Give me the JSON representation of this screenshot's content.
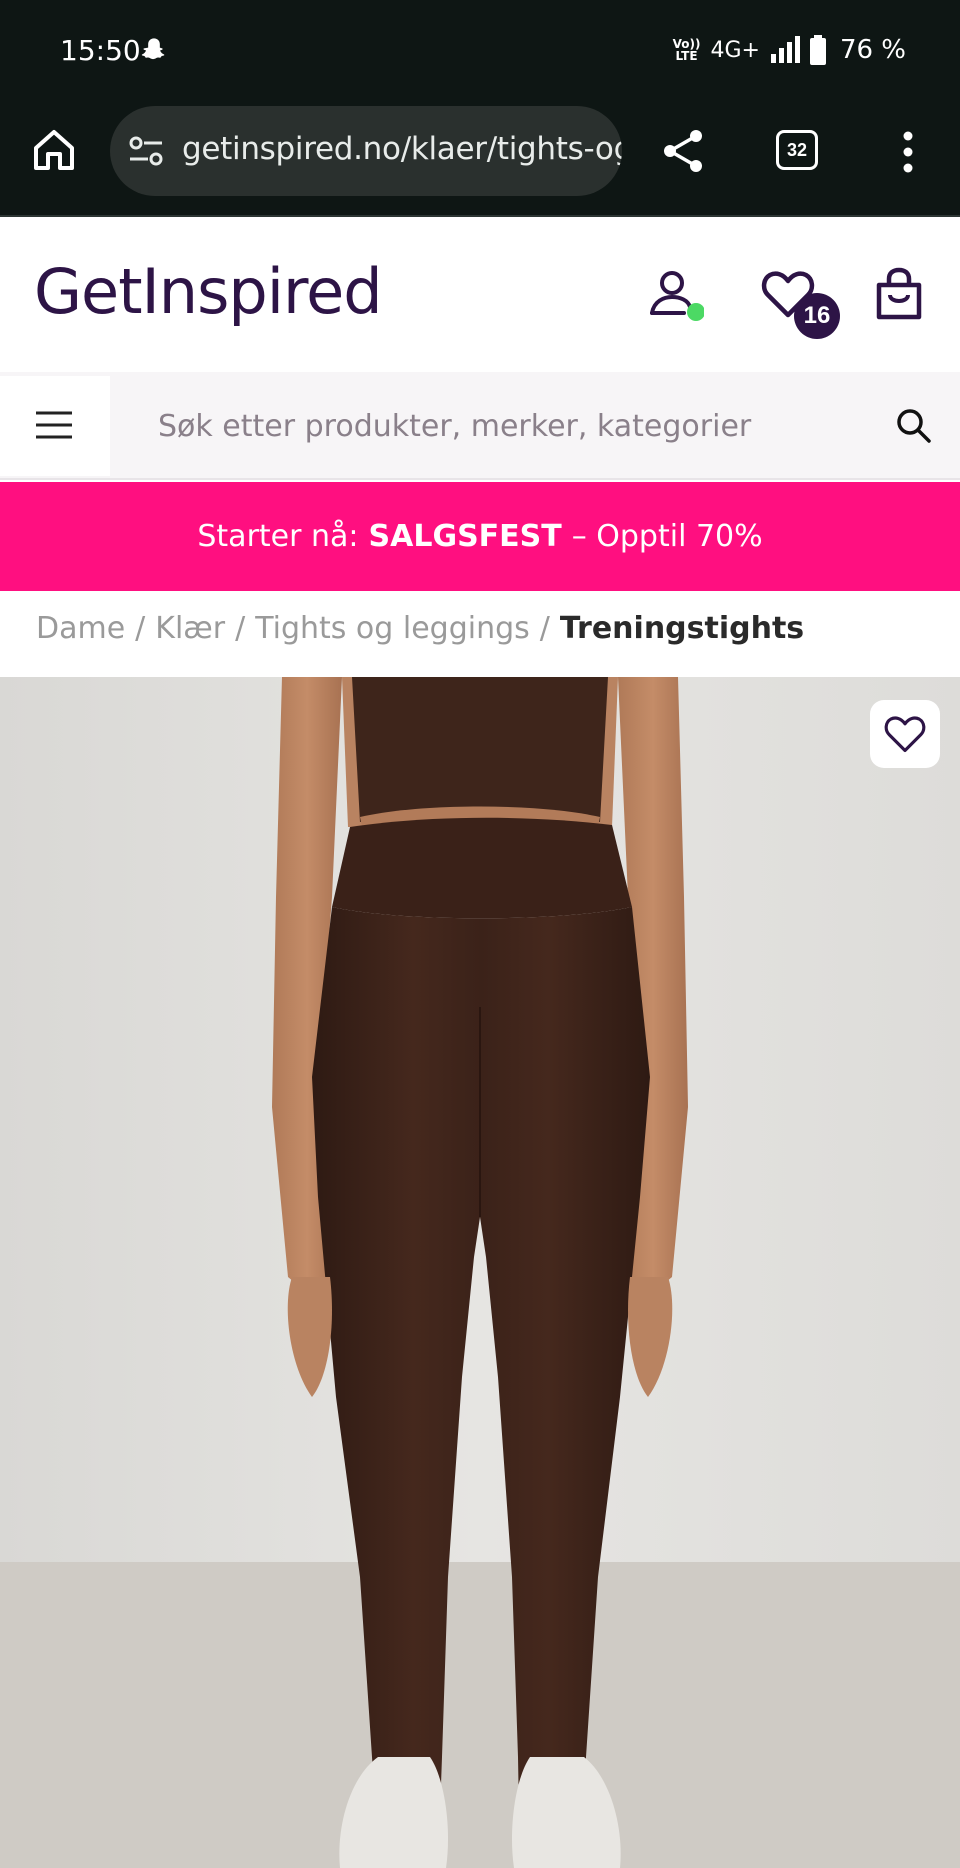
{
  "status_bar": {
    "time": "15:50",
    "volte": "VoLTE",
    "network": "4G+",
    "battery": "76 %"
  },
  "browser": {
    "url": "getinspired.no/klaer/tights-og",
    "tab_count": "32"
  },
  "header": {
    "logo": "GetInspired",
    "wishlist_count": "16"
  },
  "search": {
    "placeholder": "Søk etter produkter, merker, kategorier"
  },
  "promo": {
    "prefix": "Starter nå:",
    "highlight": "SALGSFEST",
    "suffix": "– Opptil 70%"
  },
  "breadcrumb": {
    "items": [
      "Dame",
      "Klær",
      "Tights og leggings"
    ],
    "current": "Treningstights"
  },
  "colors": {
    "brand": "#2d1446",
    "promo": "#ff0f80",
    "online_dot": "#4cd964",
    "garment": "#3b2219"
  },
  "icons": {
    "home": "home-icon",
    "site_settings": "tune-icon",
    "share": "share-icon",
    "tabs": "tabs-icon",
    "menu": "more-vert-icon",
    "account": "user-icon",
    "wishlist": "heart-icon",
    "cart": "bag-icon",
    "nav": "hamburger-icon",
    "search": "search-icon",
    "product_wishlist": "heart-outline-icon"
  }
}
